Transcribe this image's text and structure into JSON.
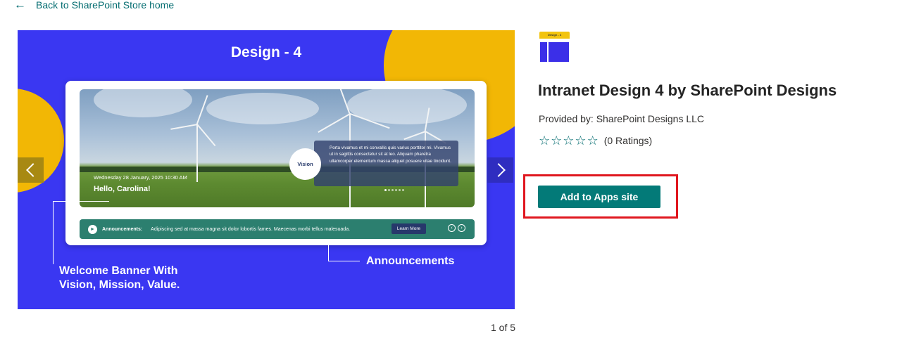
{
  "nav": {
    "back_label": "Back to SharePoint Store home",
    "back_icon": "arrow-left-icon"
  },
  "carousel": {
    "slide": {
      "title": "Design - 4",
      "banner": {
        "date": "Wednesday 28 January, 2025  10:30 AM",
        "greeting": "Hello, Carolina!",
        "vision_label": "Vision",
        "vision_text": "Porta vivamus et mi convallis quis varius porttitor mi. Vivamus ut in sagittis consectetur sit at leo. Aliquam pharetra ullamcorper elementum massa aliquet posuere vitae tincidunt."
      },
      "announcements": {
        "label": "Announcements:",
        "text": "Adipiscing sed at massa magna sit dolor lobortis fames. Maecenas morbi tellus malesuada.",
        "button_label": "Learn More"
      },
      "callout_left": "Welcome Banner With Vision, Mission, Value.",
      "callout_right": "Announcements"
    },
    "pager": "1 of 5"
  },
  "app": {
    "icon_label": "Design - 4",
    "title": "Intranet Design 4 by SharePoint Designs",
    "provider": "Provided by: SharePoint Designs LLC",
    "ratings": "(0 Ratings)",
    "add_button": "Add to Apps site"
  },
  "colors": {
    "accent": "#037a78",
    "link": "#036c70",
    "slide_bg": "#3a37f2",
    "slide_blob": "#f2b705",
    "highlight": "#e0171f"
  }
}
